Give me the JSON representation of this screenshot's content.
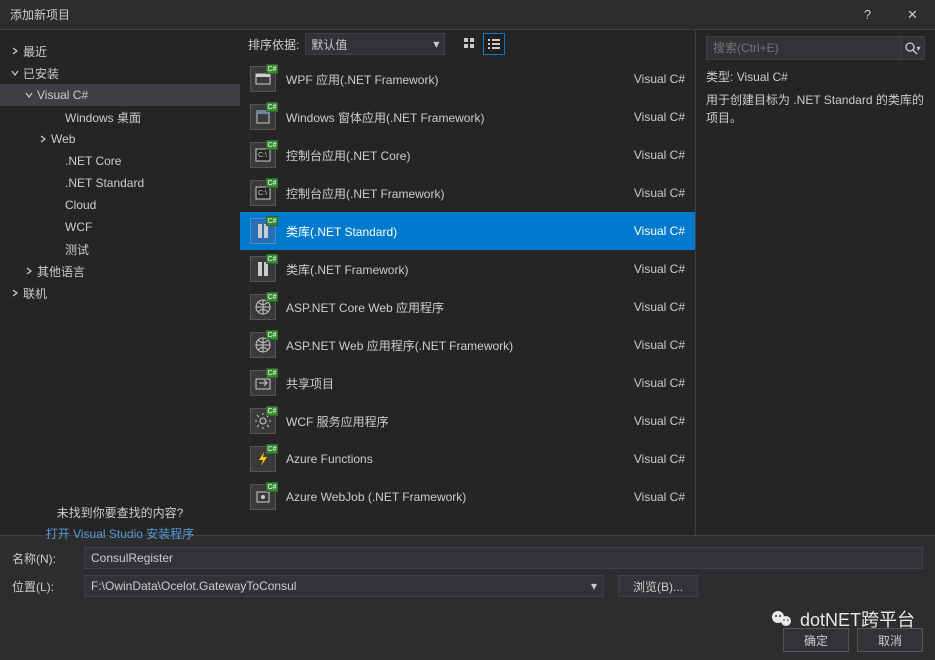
{
  "title": "添加新项目",
  "sidebar": {
    "nodes": [
      {
        "label": "最近",
        "indent": 0,
        "arrow": "right"
      },
      {
        "label": "已安装",
        "indent": 0,
        "arrow": "down"
      },
      {
        "label": "Visual C#",
        "indent": 1,
        "arrow": "down",
        "sel": true
      },
      {
        "label": "Windows 桌面",
        "indent": 3,
        "arrow": ""
      },
      {
        "label": "Web",
        "indent": 2,
        "arrow": "right"
      },
      {
        "label": ".NET Core",
        "indent": 3,
        "arrow": ""
      },
      {
        "label": ".NET Standard",
        "indent": 3,
        "arrow": ""
      },
      {
        "label": "Cloud",
        "indent": 3,
        "arrow": ""
      },
      {
        "label": "WCF",
        "indent": 3,
        "arrow": ""
      },
      {
        "label": "测试",
        "indent": 3,
        "arrow": ""
      },
      {
        "label": "其他语言",
        "indent": 1,
        "arrow": "right"
      },
      {
        "label": "联机",
        "indent": 0,
        "arrow": "right"
      }
    ],
    "not_found": "未找到你要查找的内容?",
    "open_installer": "打开 Visual Studio 安装程序"
  },
  "sort": {
    "label": "排序依据:",
    "value": "默认值"
  },
  "search": {
    "placeholder": "搜索(Ctrl+E)"
  },
  "templates": [
    {
      "name": "WPF 应用(.NET Framework)",
      "lang": "Visual C#",
      "icon": "window"
    },
    {
      "name": "Windows 窗体应用(.NET Framework)",
      "lang": "Visual C#",
      "icon": "form"
    },
    {
      "name": "控制台应用(.NET Core)",
      "lang": "Visual C#",
      "icon": "console"
    },
    {
      "name": "控制台应用(.NET Framework)",
      "lang": "Visual C#",
      "icon": "console"
    },
    {
      "name": "类库(.NET Standard)",
      "lang": "Visual C#",
      "icon": "lib",
      "selected": true
    },
    {
      "name": "类库(.NET Framework)",
      "lang": "Visual C#",
      "icon": "lib"
    },
    {
      "name": "ASP.NET Core Web 应用程序",
      "lang": "Visual C#",
      "icon": "globe"
    },
    {
      "name": "ASP.NET Web 应用程序(.NET Framework)",
      "lang": "Visual C#",
      "icon": "globe"
    },
    {
      "name": "共享项目",
      "lang": "Visual C#",
      "icon": "shared"
    },
    {
      "name": "WCF 服务应用程序",
      "lang": "Visual C#",
      "icon": "gear"
    },
    {
      "name": "Azure Functions",
      "lang": "Visual C#",
      "icon": "bolt"
    },
    {
      "name": "Azure WebJob (.NET Framework)",
      "lang": "Visual C#",
      "icon": "job"
    }
  ],
  "right": {
    "type_label": "类型:",
    "type_value": "Visual C#",
    "description": "用于创建目标为 .NET Standard 的类库的项目。"
  },
  "fields": {
    "name_label": "名称(N):",
    "name_value": "ConsulRegister",
    "location_label": "位置(L):",
    "location_value": "F:\\OwinData\\Ocelot.GatewayToConsul",
    "browse": "浏览(B)..."
  },
  "buttons": {
    "ok": "确定",
    "cancel": "取消"
  },
  "watermark": "dotNET跨平台"
}
